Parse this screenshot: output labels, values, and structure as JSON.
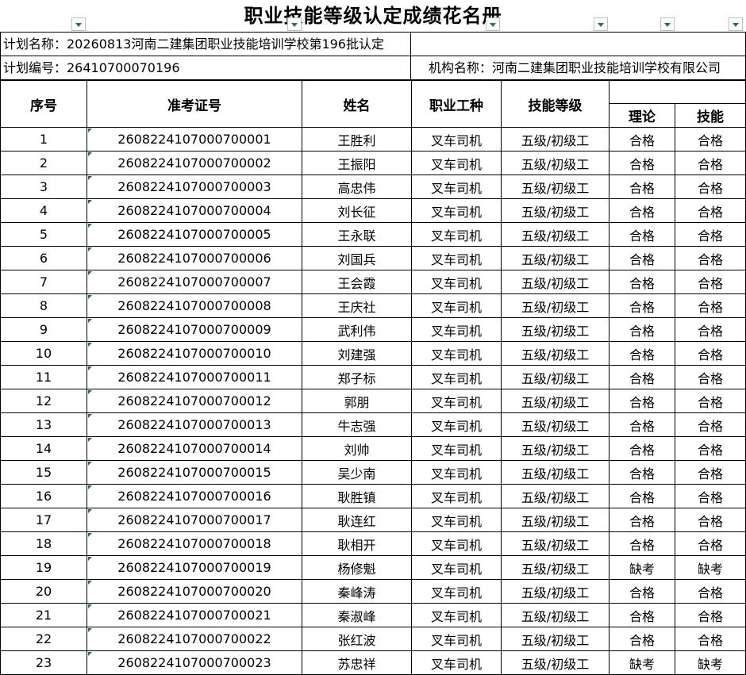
{
  "title": "职业技能等级认定成绩花名册",
  "plan_name": "计划名称：20260813河南二建集团职业技能培训学校第196批认定",
  "plan_number": "计划编号：26410700070196",
  "org_name": "机构名称：河南二建集团职业技能培训学校有限公司",
  "headers": {
    "index": "序号",
    "ticket": "准考证号",
    "name": "姓名",
    "occupation": "职业工种",
    "level": "技能等级",
    "theory": "理论",
    "skill": "技能"
  },
  "filter_icons": [
    "chevron-down-icon"
  ],
  "colors": {
    "filter_arrow": "#1d7a3f",
    "grid": "#000000"
  },
  "rows": [
    {
      "index": "1",
      "ticket": "2608224107000700001",
      "name": "王胜利",
      "occupation": "叉车司机",
      "level": "五级/初级工",
      "theory": "合格",
      "skill": "合格"
    },
    {
      "index": "2",
      "ticket": "2608224107000700002",
      "name": "王振阳",
      "occupation": "叉车司机",
      "level": "五级/初级工",
      "theory": "合格",
      "skill": "合格"
    },
    {
      "index": "3",
      "ticket": "2608224107000700003",
      "name": "高忠伟",
      "occupation": "叉车司机",
      "level": "五级/初级工",
      "theory": "合格",
      "skill": "合格"
    },
    {
      "index": "4",
      "ticket": "2608224107000700004",
      "name": "刘长征",
      "occupation": "叉车司机",
      "level": "五级/初级工",
      "theory": "合格",
      "skill": "合格"
    },
    {
      "index": "5",
      "ticket": "2608224107000700005",
      "name": "王永联",
      "occupation": "叉车司机",
      "level": "五级/初级工",
      "theory": "合格",
      "skill": "合格"
    },
    {
      "index": "6",
      "ticket": "2608224107000700006",
      "name": "刘国兵",
      "occupation": "叉车司机",
      "level": "五级/初级工",
      "theory": "合格",
      "skill": "合格"
    },
    {
      "index": "7",
      "ticket": "2608224107000700007",
      "name": "王会霞",
      "occupation": "叉车司机",
      "level": "五级/初级工",
      "theory": "合格",
      "skill": "合格"
    },
    {
      "index": "8",
      "ticket": "2608224107000700008",
      "name": "王庆社",
      "occupation": "叉车司机",
      "level": "五级/初级工",
      "theory": "合格",
      "skill": "合格"
    },
    {
      "index": "9",
      "ticket": "2608224107000700009",
      "name": "武利伟",
      "occupation": "叉车司机",
      "level": "五级/初级工",
      "theory": "合格",
      "skill": "合格"
    },
    {
      "index": "10",
      "ticket": "2608224107000700010",
      "name": "刘建强",
      "occupation": "叉车司机",
      "level": "五级/初级工",
      "theory": "合格",
      "skill": "合格"
    },
    {
      "index": "11",
      "ticket": "2608224107000700011",
      "name": "郑子标",
      "occupation": "叉车司机",
      "level": "五级/初级工",
      "theory": "合格",
      "skill": "合格"
    },
    {
      "index": "12",
      "ticket": "2608224107000700012",
      "name": "郭朋",
      "occupation": "叉车司机",
      "level": "五级/初级工",
      "theory": "合格",
      "skill": "合格"
    },
    {
      "index": "13",
      "ticket": "2608224107000700013",
      "name": "牛志强",
      "occupation": "叉车司机",
      "level": "五级/初级工",
      "theory": "合格",
      "skill": "合格"
    },
    {
      "index": "14",
      "ticket": "2608224107000700014",
      "name": "刘帅",
      "occupation": "叉车司机",
      "level": "五级/初级工",
      "theory": "合格",
      "skill": "合格"
    },
    {
      "index": "15",
      "ticket": "2608224107000700015",
      "name": "吴少南",
      "occupation": "叉车司机",
      "level": "五级/初级工",
      "theory": "合格",
      "skill": "合格"
    },
    {
      "index": "16",
      "ticket": "2608224107000700016",
      "name": "耿胜镇",
      "occupation": "叉车司机",
      "level": "五级/初级工",
      "theory": "合格",
      "skill": "合格"
    },
    {
      "index": "17",
      "ticket": "2608224107000700017",
      "name": "耿连红",
      "occupation": "叉车司机",
      "level": "五级/初级工",
      "theory": "合格",
      "skill": "合格"
    },
    {
      "index": "18",
      "ticket": "2608224107000700018",
      "name": "耿相开",
      "occupation": "叉车司机",
      "level": "五级/初级工",
      "theory": "合格",
      "skill": "合格"
    },
    {
      "index": "19",
      "ticket": "2608224107000700019",
      "name": "杨修魁",
      "occupation": "叉车司机",
      "level": "五级/初级工",
      "theory": "缺考",
      "skill": "缺考"
    },
    {
      "index": "20",
      "ticket": "2608224107000700020",
      "name": "秦峰涛",
      "occupation": "叉车司机",
      "level": "五级/初级工",
      "theory": "合格",
      "skill": "合格"
    },
    {
      "index": "21",
      "ticket": "2608224107000700021",
      "name": "秦淑峰",
      "occupation": "叉车司机",
      "level": "五级/初级工",
      "theory": "合格",
      "skill": "合格"
    },
    {
      "index": "22",
      "ticket": "2608224107000700022",
      "name": "张红波",
      "occupation": "叉车司机",
      "level": "五级/初级工",
      "theory": "合格",
      "skill": "合格"
    },
    {
      "index": "23",
      "ticket": "2608224107000700023",
      "name": "苏忠祥",
      "occupation": "叉车司机",
      "level": "五级/初级工",
      "theory": "缺考",
      "skill": "缺考"
    }
  ]
}
